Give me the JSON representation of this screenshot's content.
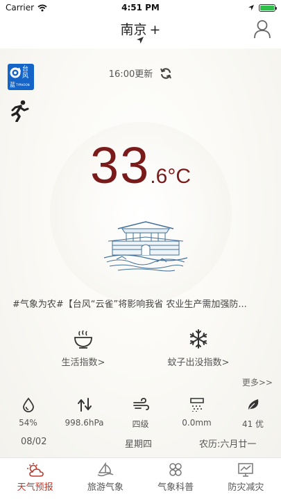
{
  "status_bar": {
    "carrier": "Carrier",
    "time": "4:51 PM",
    "battery_level": 1.0
  },
  "header": {
    "city": "南京",
    "add_symbol": "+"
  },
  "typhoon_badge": {
    "title": "台风",
    "level": "蓝",
    "subtitle": "TYPHOON",
    "color": "#1565c8"
  },
  "update": {
    "text": "16:00更新"
  },
  "temperature": {
    "integer": "33",
    "decimal": ".6",
    "unit": "°C",
    "color": "#7a1b1b"
  },
  "news": {
    "text": "#气象为农#【台风“云雀”将影响我省  农业生产需加强防..."
  },
  "indices": [
    {
      "label": "生活指数>",
      "icon": "bowl-icon"
    },
    {
      "label": "蚊子出没指数>",
      "icon": "snowflake-icon"
    }
  ],
  "more": {
    "label": "更多>>"
  },
  "stats": [
    {
      "icon": "humidity-icon",
      "value": "54%"
    },
    {
      "icon": "pressure-icon",
      "value": "998.6hPa"
    },
    {
      "icon": "wind-icon",
      "value": "四级"
    },
    {
      "icon": "rain-icon",
      "value": "0.0mm"
    },
    {
      "icon": "leaf-icon",
      "value": "41 优"
    }
  ],
  "date_row": {
    "date": "08/02",
    "weekday": "星期四",
    "lunar": "农历:六月廿一"
  },
  "tabs": [
    {
      "label": "天气预报",
      "active": true
    },
    {
      "label": "旅游气象",
      "active": false
    },
    {
      "label": "气象科普",
      "active": false
    },
    {
      "label": "防灾减灾",
      "active": false
    }
  ],
  "colors": {
    "accent": "#c0392b",
    "text": "#333333"
  }
}
